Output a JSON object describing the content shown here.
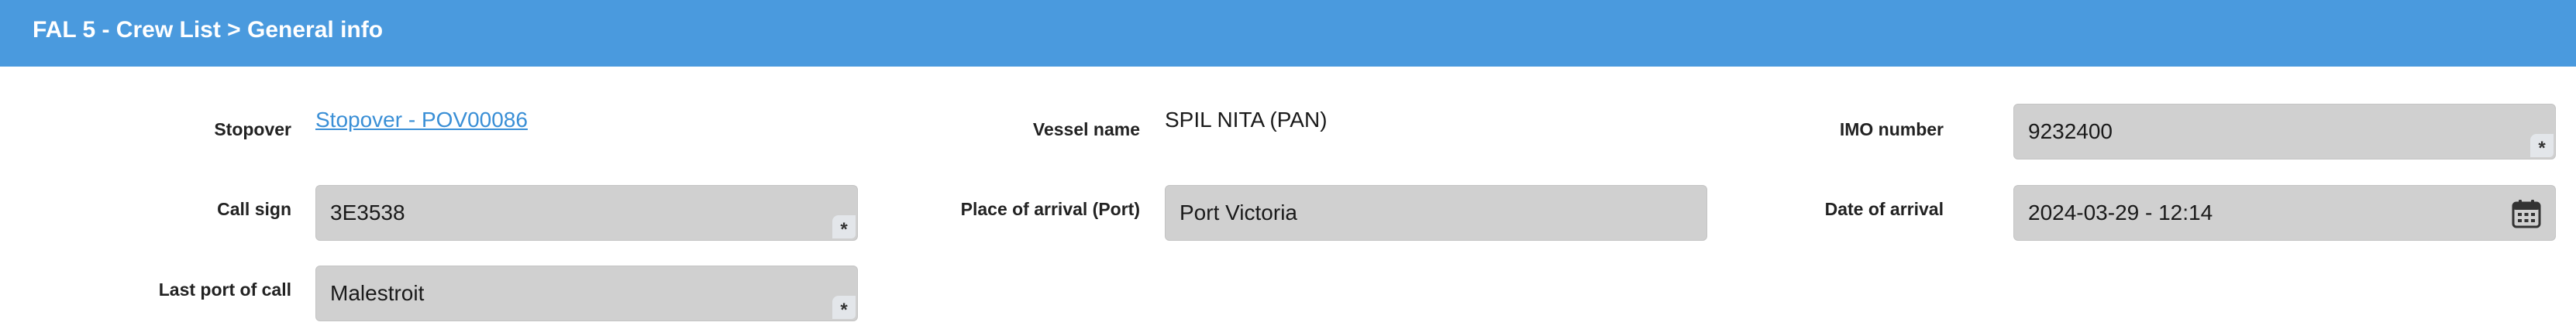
{
  "header": {
    "title": "FAL 5 - Crew List > General info"
  },
  "fields": {
    "stopover": {
      "label": "Stopover",
      "link_text": "Stopover - POV00086"
    },
    "vessel_name": {
      "label": "Vessel name",
      "value": "SPIL NITA (PAN)"
    },
    "imo_number": {
      "label": "IMO number",
      "value": "9232400",
      "required_marker": "*"
    },
    "call_sign": {
      "label": "Call sign",
      "value": "3E3538",
      "required_marker": "*"
    },
    "place_of_arrival": {
      "label": "Place of arrival (Port)",
      "value": "Port Victoria"
    },
    "date_of_arrival": {
      "label": "Date of arrival",
      "value": "2024-03-29 - 12:14",
      "icon": "calendar-icon"
    },
    "last_port_of_call": {
      "label": "Last port of call",
      "value": "Malestroit",
      "required_marker": "*"
    }
  },
  "colors": {
    "header_bg": "#4a9ade",
    "field_bg": "#d0d0d0",
    "link": "#3a8fd6"
  }
}
